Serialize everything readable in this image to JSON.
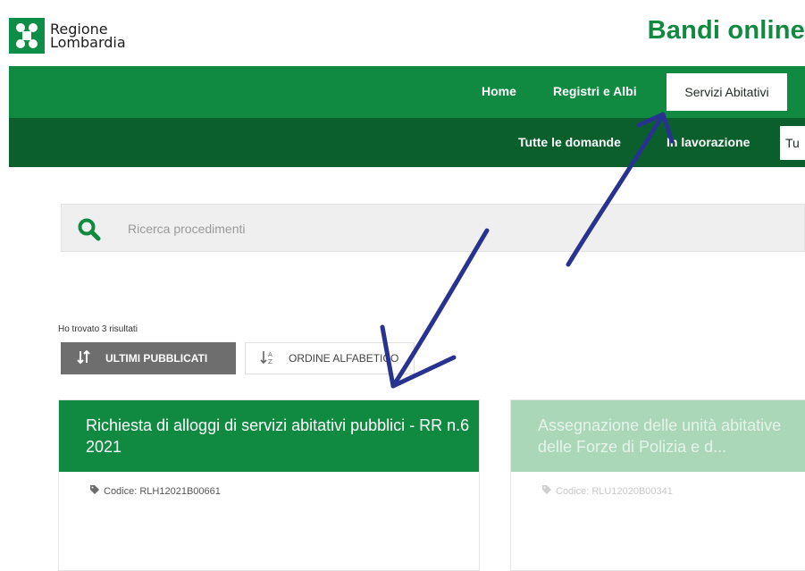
{
  "header": {
    "logo_line1": "Regione",
    "logo_line2": "Lombardia",
    "app_title": "Bandi online"
  },
  "nav_primary": [
    {
      "label": "Home"
    },
    {
      "label": "Registri e Albi"
    },
    {
      "label": "Servizi Abitativi",
      "active": true
    }
  ],
  "nav_secondary": [
    {
      "label": "Tutte le domande"
    },
    {
      "label": "In lavorazione"
    },
    {
      "label": "Tu",
      "active": true
    }
  ],
  "search": {
    "placeholder": "Ricerca procedimenti"
  },
  "results_text": "Ho trovato 3 risultati",
  "sort": {
    "latest_label": "ULTIMI PUBBLICATI",
    "alpha_label": "ORDINE ALFABETICO"
  },
  "cards": [
    {
      "title": "Richiesta di alloggi di servizi abitativi pubblici - RR n.6 2021",
      "code_label": "Codice:",
      "code_value": "RLH12021B00661"
    },
    {
      "title": "Assegnazione delle unità abitative delle Forze di Polizia e d...",
      "code_label": "Codice:",
      "code_value": "RLU12020B00341"
    }
  ],
  "colors": {
    "brand_green": "#0f8a40",
    "dark_green": "#0a5f2d",
    "annotation_blue": "#27338f"
  }
}
